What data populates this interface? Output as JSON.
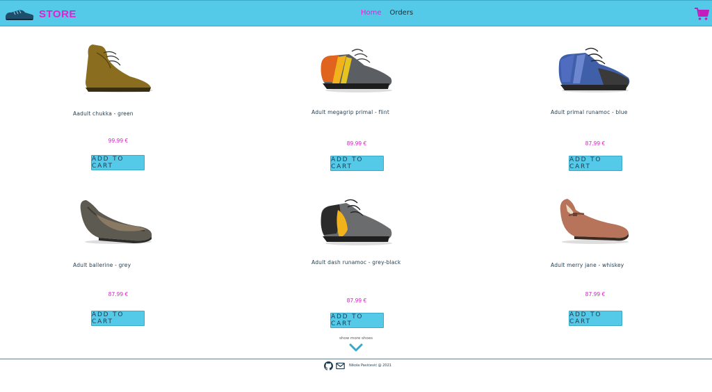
{
  "brand": {
    "name": "STORE",
    "logo_icon": "shoe-logo-icon"
  },
  "nav": {
    "items": [
      {
        "label": "Home",
        "active": true
      },
      {
        "label": "Orders",
        "active": false
      }
    ]
  },
  "cart": {
    "icon": "shopping-cart-icon"
  },
  "colors": {
    "header_bg": "#55c9e8",
    "accent": "#e51fd1",
    "button_bg": "#55c9e8",
    "price": "#d81ec8"
  },
  "products": [
    {
      "name": "Aadult chukka - green",
      "price": "99.99 €",
      "button": "ADD TO CART"
    },
    {
      "name": "Adult megagrip primal - flint",
      "price": "89.99 €",
      "button": "ADD TO CART"
    },
    {
      "name": "Adult primal runamoc - blue",
      "price": "87.99 €",
      "button": "ADD TO CART"
    },
    {
      "name": "Adult ballerine - grey",
      "price": "87.99 €",
      "button": "ADD TO CART"
    },
    {
      "name": "Adult dash runamoc - grey-black",
      "price": "87.99 €",
      "button": "ADD TO CART"
    },
    {
      "name": "Adult merry jane - whiskey",
      "price": "87.99 €",
      "button": "ADD TO CART"
    }
  ],
  "show_more": {
    "label": "show more shoes",
    "icon": "chevron-down-icon"
  },
  "footer": {
    "text": "Nikola Pavićević @ 2021",
    "icons": [
      "github-icon",
      "mail-icon"
    ]
  }
}
